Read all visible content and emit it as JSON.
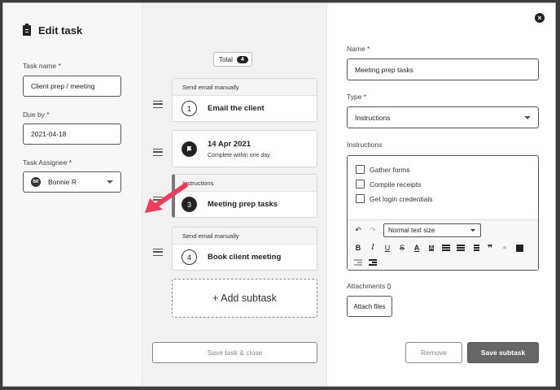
{
  "left_panel": {
    "title": "Edit task",
    "task_name_label": "Task name *",
    "task_name_value": "Client prep / meeting",
    "due_by_label": "Due by *",
    "due_by_value": "2021-04-18",
    "assignee_label": "Task Assignee *",
    "assignee_initials": "BR",
    "assignee_name": "Bonnie R"
  },
  "middle_panel": {
    "total_label": "Total",
    "total_count": "4",
    "subtasks": [
      {
        "header": "Send email manually",
        "number": "1",
        "name": "Email the client"
      },
      {
        "header": "",
        "name": "14 Apr 2021",
        "sub": "Complete within one day",
        "icon": "flag-icon"
      },
      {
        "header": "Instructions",
        "number": "3",
        "name": "Meeting prep tasks"
      },
      {
        "header": "Send email manually",
        "number": "4",
        "name": "Book client meeting"
      }
    ],
    "add_subtask_label": "+ Add subtask",
    "save_close_label": "Save task & close"
  },
  "right_panel": {
    "name_label": "Name *",
    "name_value": "Meeting prep tasks",
    "type_label": "Type *",
    "type_value": "Instructions",
    "instructions_label": "Instructions",
    "checklist": [
      "Gather forms",
      "Compile receipts",
      "Get login credentials"
    ],
    "text_style": "Normal text size",
    "attachments_label": "Attachments",
    "attach_files_label": "Attach files",
    "remove_label": "Remove",
    "save_subtask_label": "Save subtask"
  },
  "colors": {
    "annotation_arrow": "#ee3d5b",
    "primary_button": "#666666",
    "dark": "#222222"
  }
}
